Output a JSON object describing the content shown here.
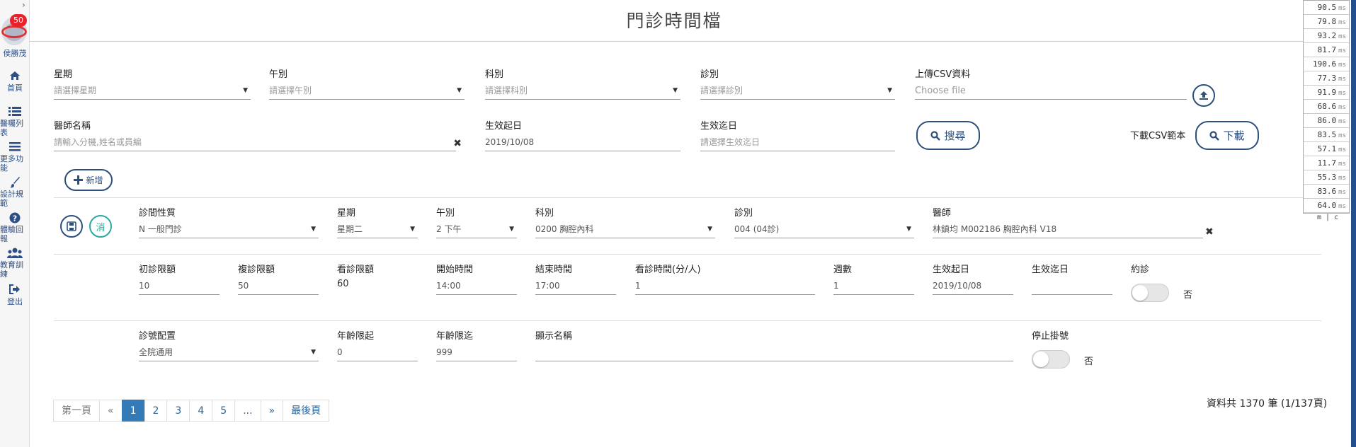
{
  "sidebar": {
    "toggle": "›",
    "badge": "50",
    "user": "侯勝茂",
    "items": [
      {
        "icon": "home-icon",
        "label": "首頁"
      },
      {
        "icon": "list-icon",
        "label": "醫囑列\n表"
      },
      {
        "icon": "bars-icon",
        "label": "更多功\n能"
      },
      {
        "icon": "paintbrush-icon",
        "label": "設計規\n範"
      },
      {
        "icon": "question-icon",
        "label": "體驗回\n報"
      },
      {
        "icon": "users-icon",
        "label": "教育訓\n練"
      },
      {
        "icon": "logout-icon",
        "label": "登出"
      }
    ]
  },
  "page": {
    "title": "門診時間檔"
  },
  "search": {
    "week": {
      "label": "星期",
      "placeholder": "請選擇星期"
    },
    "period": {
      "label": "午別",
      "placeholder": "請選擇午別"
    },
    "dept": {
      "label": "科別",
      "placeholder": "請選擇科別"
    },
    "clinic": {
      "label": "診別",
      "placeholder": "請選擇診別"
    },
    "csv": {
      "label": "上傳CSV資料",
      "placeholder": "Choose file"
    },
    "doctor": {
      "label": "醫師名稱",
      "placeholder": "請輸入分機,姓名或員編"
    },
    "start": {
      "label": "生效起日",
      "value": "2019/10/08"
    },
    "end": {
      "label": "生效迄日",
      "placeholder": "請選擇生效迄日"
    },
    "search_btn": "搜尋",
    "download_label": "下載CSV範本",
    "download_btn": "下載",
    "add_btn": "新增"
  },
  "record": {
    "cancel_label": "消",
    "nature": {
      "label": "診間性質",
      "value": "N 一般門診"
    },
    "week": {
      "label": "星期",
      "value": "星期二"
    },
    "period": {
      "label": "午別",
      "value": "2 下午"
    },
    "dept": {
      "label": "科別",
      "value": "0200 胸腔內科"
    },
    "clinic": {
      "label": "診別",
      "value": "004 (04診)"
    },
    "doctor": {
      "label": "醫師",
      "value": "林鎮均 M002186 胸腔內科 V18"
    },
    "first_limit": {
      "label": "初診限額",
      "value": "10"
    },
    "re_limit": {
      "label": "複診限額",
      "value": "50"
    },
    "view_limit": {
      "label": "看診限額",
      "value": "60"
    },
    "start_time": {
      "label": "開始時間",
      "value": "14:00"
    },
    "end_time": {
      "label": "結束時間",
      "value": "17:00"
    },
    "per_person": {
      "label": "看診時間(分/人)",
      "value": "1"
    },
    "weeks": {
      "label": "週數",
      "value": "1"
    },
    "eff_start": {
      "label": "生效起日",
      "value": "2019/10/08"
    },
    "eff_end": {
      "label": "生效迄日",
      "value": ""
    },
    "appointment": {
      "label": "約診",
      "state": "否"
    },
    "numbering": {
      "label": "診號配置",
      "value": "全院通用"
    },
    "age_min": {
      "label": "年齡限起",
      "value": "0"
    },
    "age_max": {
      "label": "年齡限迄",
      "value": "999"
    },
    "display_name": {
      "label": "顯示名稱",
      "value": ""
    },
    "stop_reg": {
      "label": "停止掛號",
      "state": "否"
    }
  },
  "pagination": {
    "first": "第一頁",
    "prev": "«",
    "pages": [
      "1",
      "2",
      "3",
      "4",
      "5"
    ],
    "ellipsis": "...",
    "next": "»",
    "last": "最後頁",
    "active": "1",
    "summary": "資料共 1370 筆 (1/137頁)"
  },
  "perf": {
    "values": [
      "90.5",
      "79.8",
      "93.2",
      "81.7",
      "190.6",
      "77.3",
      "91.9",
      "68.6",
      "86.0",
      "83.5",
      "57.1",
      "11.7",
      "55.3",
      "83.6",
      "64.0"
    ],
    "unit": "ms",
    "footer": "m | c"
  },
  "colors": {
    "primary": "#2c4f7c",
    "teal": "#2aa99e",
    "badge": "#e8212b",
    "active_page": "#337ab7"
  }
}
